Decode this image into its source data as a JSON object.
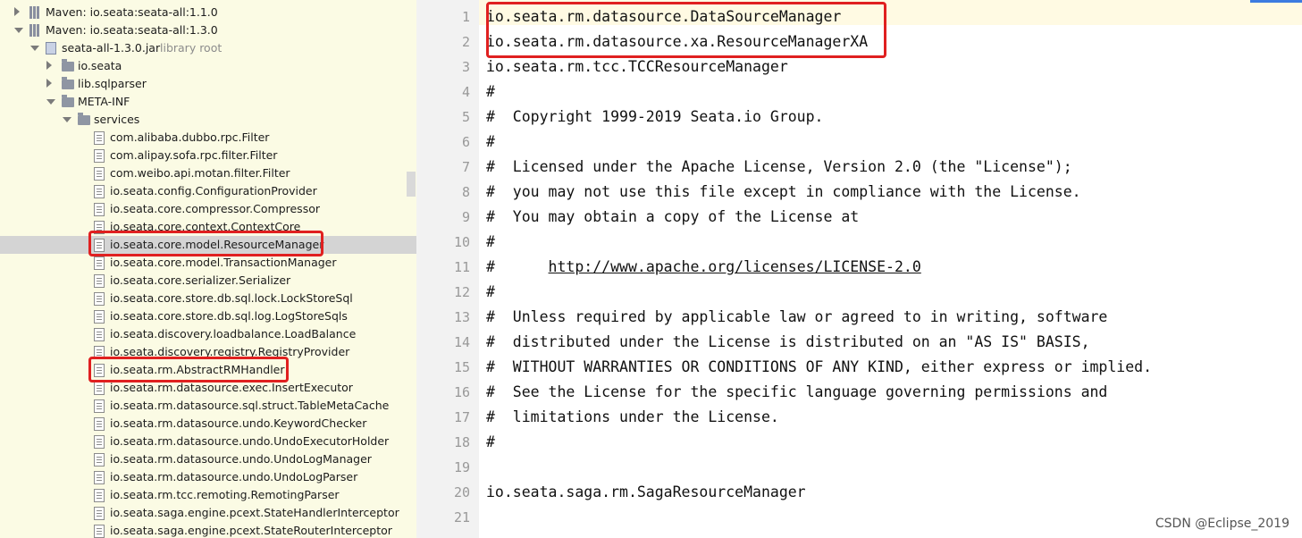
{
  "tree": {
    "items": [
      {
        "label": "Maven: io.seata:seata-all:1.1.0",
        "arrow": "right",
        "icon": "library-icon",
        "indent": 0
      },
      {
        "label": "Maven: io.seata:seata-all:1.3.0",
        "arrow": "down",
        "icon": "library-icon",
        "indent": 0
      },
      {
        "label": "seata-all-1.3.0.jar",
        "note": "library root",
        "arrow": "down",
        "icon": "jar-icon",
        "indent": 1
      },
      {
        "label": "io.seata",
        "arrow": "right",
        "icon": "folder-icon",
        "indent": 2
      },
      {
        "label": "lib.sqlparser",
        "arrow": "right",
        "icon": "folder-icon",
        "indent": 2
      },
      {
        "label": "META-INF",
        "arrow": "down",
        "icon": "folder-icon",
        "indent": 2
      },
      {
        "label": "services",
        "arrow": "down",
        "icon": "folder-icon",
        "indent": 3
      },
      {
        "label": "com.alibaba.dubbo.rpc.Filter",
        "icon": "file-icon",
        "indent": 4
      },
      {
        "label": "com.alipay.sofa.rpc.filter.Filter",
        "icon": "file-icon",
        "indent": 4
      },
      {
        "label": "com.weibo.api.motan.filter.Filter",
        "icon": "file-icon",
        "indent": 4
      },
      {
        "label": "io.seata.config.ConfigurationProvider",
        "icon": "file-icon",
        "indent": 4
      },
      {
        "label": "io.seata.core.compressor.Compressor",
        "icon": "file-icon",
        "indent": 4
      },
      {
        "label": "io.seata.core.context.ContextCore",
        "icon": "file-icon",
        "indent": 4
      },
      {
        "label": "io.seata.core.model.ResourceManager",
        "icon": "file-icon",
        "indent": 4,
        "selected": true
      },
      {
        "label": "io.seata.core.model.TransactionManager",
        "icon": "file-icon",
        "indent": 4
      },
      {
        "label": "io.seata.core.serializer.Serializer",
        "icon": "file-icon",
        "indent": 4
      },
      {
        "label": "io.seata.core.store.db.sql.lock.LockStoreSql",
        "icon": "file-icon",
        "indent": 4
      },
      {
        "label": "io.seata.core.store.db.sql.log.LogStoreSqls",
        "icon": "file-icon",
        "indent": 4
      },
      {
        "label": "io.seata.discovery.loadbalance.LoadBalance",
        "icon": "file-icon",
        "indent": 4
      },
      {
        "label": "io.seata.discovery.registry.RegistryProvider",
        "icon": "file-icon",
        "indent": 4
      },
      {
        "label": "io.seata.rm.AbstractRMHandler",
        "icon": "file-icon",
        "indent": 4
      },
      {
        "label": "io.seata.rm.datasource.exec.InsertExecutor",
        "icon": "file-icon",
        "indent": 4
      },
      {
        "label": "io.seata.rm.datasource.sql.struct.TableMetaCache",
        "icon": "file-icon",
        "indent": 4
      },
      {
        "label": "io.seata.rm.datasource.undo.KeywordChecker",
        "icon": "file-icon",
        "indent": 4
      },
      {
        "label": "io.seata.rm.datasource.undo.UndoExecutorHolder",
        "icon": "file-icon",
        "indent": 4
      },
      {
        "label": "io.seata.rm.datasource.undo.UndoLogManager",
        "icon": "file-icon",
        "indent": 4
      },
      {
        "label": "io.seata.rm.datasource.undo.UndoLogParser",
        "icon": "file-icon",
        "indent": 4
      },
      {
        "label": "io.seata.rm.tcc.remoting.RemotingParser",
        "icon": "file-icon",
        "indent": 4
      },
      {
        "label": "io.seata.saga.engine.pcext.StateHandlerInterceptor",
        "icon": "file-icon",
        "indent": 4
      },
      {
        "label": "io.seata.saga.engine.pcext.StateRouterInterceptor",
        "icon": "file-icon",
        "indent": 4
      }
    ]
  },
  "editor": {
    "lines": [
      {
        "num": "1",
        "text": "io.seata.rm.datasource.DataSourceManager",
        "hl": true
      },
      {
        "num": "2",
        "text": "io.seata.rm.datasource.xa.ResourceManagerXA",
        "hl": true
      },
      {
        "num": "3",
        "text": "io.seata.rm.tcc.TCCResourceManager",
        "hl": true
      },
      {
        "num": "4",
        "text": "#"
      },
      {
        "num": "5",
        "text": "#  Copyright 1999-2019 Seata.io Group."
      },
      {
        "num": "6",
        "text": "#"
      },
      {
        "num": "7",
        "text": "#  Licensed under the Apache License, Version 2.0 (the \"License\");"
      },
      {
        "num": "8",
        "text": "#  you may not use this file except in compliance with the License."
      },
      {
        "num": "9",
        "text": "#  You may obtain a copy of the License at"
      },
      {
        "num": "10",
        "text": "#"
      },
      {
        "num": "11",
        "text": "#",
        "link": "http://www.apache.org/licenses/LICENSE-2.0"
      },
      {
        "num": "12",
        "text": "#"
      },
      {
        "num": "13",
        "text": "#  Unless required by applicable law or agreed to in writing, software"
      },
      {
        "num": "14",
        "text": "#  distributed under the License is distributed on an \"AS IS\" BASIS,"
      },
      {
        "num": "15",
        "text": "#  WITHOUT WARRANTIES OR CONDITIONS OF ANY KIND, either express or implied."
      },
      {
        "num": "16",
        "text": "#  See the License for the specific language governing permissions and"
      },
      {
        "num": "17",
        "text": "#  limitations under the License."
      },
      {
        "num": "18",
        "text": "#"
      },
      {
        "num": "19",
        "text": ""
      },
      {
        "num": "20",
        "text": "io.seata.saga.rm.SagaResourceManager",
        "hl": true
      },
      {
        "num": "21",
        "text": ""
      }
    ]
  },
  "watermark": "CSDN @Eclipse_2019"
}
